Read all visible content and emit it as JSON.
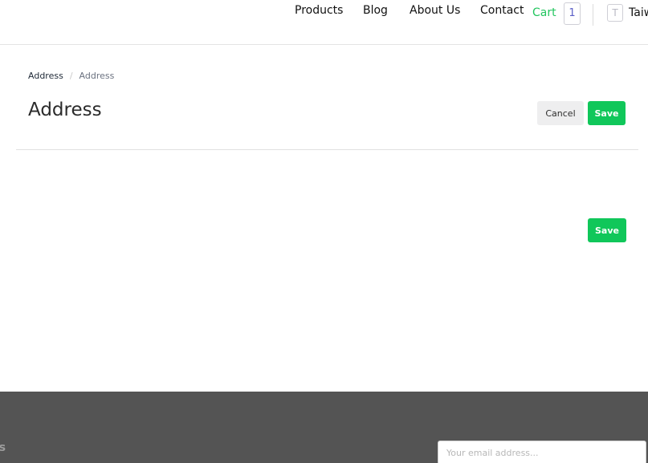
{
  "header": {
    "nav": {
      "products": "Products",
      "blog": "Blog",
      "about": "About Us",
      "contact": "Contact"
    },
    "cart": {
      "label": "Cart",
      "count": "1"
    },
    "user": {
      "initial": "T",
      "name": "Taiw"
    }
  },
  "breadcrumb": {
    "home": "Address",
    "separator": "/",
    "current": "Address"
  },
  "page": {
    "title": "Address",
    "cancel_label": "Cancel",
    "save_label": "Save",
    "save_bottom_label": "Save"
  },
  "footer": {
    "heading_fragment": "ts",
    "newsletter_placeholder": "Your email address..."
  },
  "colors": {
    "accent_green": "#10c75a",
    "cart_green": "#22c55e",
    "footer_bg": "#545454"
  }
}
